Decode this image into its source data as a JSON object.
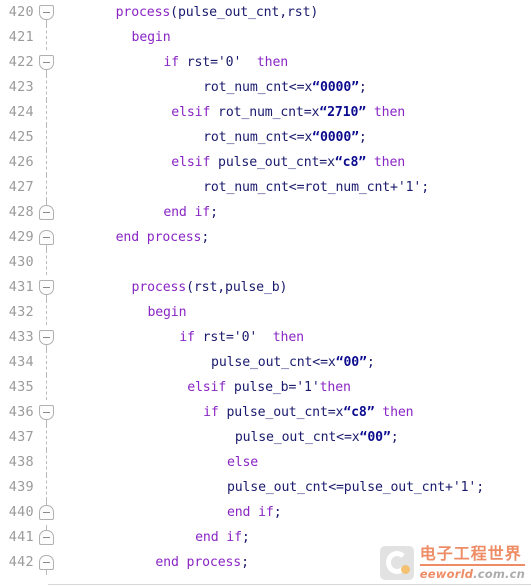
{
  "editor": {
    "title": "VHDL code listing",
    "language": "VHDL",
    "first_line": 420,
    "last_line": 442,
    "colors": {
      "background": "#ffffff",
      "line_number": "#9b9b9b",
      "identifier": "#101078",
      "keyword": "#8a26c4",
      "string": "#0b0b8f",
      "fold_marker": "#b0b0b0"
    }
  },
  "lines": [
    {
      "number": "420",
      "fold": "start",
      "connector": "bottom-half",
      "indent": 7,
      "tokens": [
        {
          "t": "kw",
          "v": "process"
        },
        {
          "t": "pun",
          "v": "(pulse_out_cnt,rst)"
        }
      ]
    },
    {
      "number": "421",
      "fold": "none",
      "connector": "full",
      "indent": 9,
      "tokens": [
        {
          "t": "kw",
          "v": "begin"
        }
      ]
    },
    {
      "number": "422",
      "fold": "start",
      "connector": "bottom-half",
      "indent": 13,
      "tokens": [
        {
          "t": "kw",
          "v": "if"
        },
        {
          "t": "pun",
          "v": " rst="
        },
        {
          "t": "pun",
          "v": "'0'"
        },
        {
          "t": "pun",
          "v": "  "
        },
        {
          "t": "kw",
          "v": "then"
        }
      ]
    },
    {
      "number": "423",
      "fold": "none",
      "connector": "full",
      "indent": 18,
      "tokens": [
        {
          "t": "pun",
          "v": "rot_num_cnt<=x"
        },
        {
          "t": "str",
          "v": "“0000”"
        },
        {
          "t": "pun",
          "v": ";"
        }
      ]
    },
    {
      "number": "424",
      "fold": "none",
      "connector": "full",
      "indent": 14,
      "tokens": [
        {
          "t": "kw",
          "v": "elsif"
        },
        {
          "t": "pun",
          "v": " rot_num_cnt=x"
        },
        {
          "t": "str",
          "v": "“2710”"
        },
        {
          "t": "pun",
          "v": " "
        },
        {
          "t": "kw",
          "v": "then"
        }
      ]
    },
    {
      "number": "425",
      "fold": "none",
      "connector": "full",
      "indent": 18,
      "tokens": [
        {
          "t": "pun",
          "v": "rot_num_cnt<=x"
        },
        {
          "t": "str",
          "v": "“0000”"
        },
        {
          "t": "pun",
          "v": ";"
        }
      ]
    },
    {
      "number": "426",
      "fold": "none",
      "connector": "full",
      "indent": 14,
      "tokens": [
        {
          "t": "kw",
          "v": "elsif"
        },
        {
          "t": "pun",
          "v": " pulse_out_cnt=x"
        },
        {
          "t": "str",
          "v": "“c8”"
        },
        {
          "t": "pun",
          "v": " "
        },
        {
          "t": "kw",
          "v": "then"
        }
      ]
    },
    {
      "number": "427",
      "fold": "none",
      "connector": "full",
      "indent": 18,
      "tokens": [
        {
          "t": "pun",
          "v": "rot_num_cnt<=rot_num_cnt+"
        },
        {
          "t": "pun",
          "v": "'1'"
        },
        {
          "t": "pun",
          "v": ";"
        }
      ]
    },
    {
      "number": "428",
      "fold": "end",
      "connector": "top-half",
      "indent": 13,
      "tokens": [
        {
          "t": "kw",
          "v": "end if"
        },
        {
          "t": "pun",
          "v": ";"
        }
      ]
    },
    {
      "number": "429",
      "fold": "end",
      "connector": "bottom-half",
      "indent": 7,
      "tokens": [
        {
          "t": "kw",
          "v": "end process"
        },
        {
          "t": "pun",
          "v": ";"
        }
      ]
    },
    {
      "number": "430",
      "fold": "none",
      "connector": "full",
      "indent": 0,
      "tokens": []
    },
    {
      "number": "431",
      "fold": "start",
      "connector": "bottom-half",
      "indent": 9,
      "tokens": [
        {
          "t": "kw",
          "v": "process"
        },
        {
          "t": "pun",
          "v": "(rst,pulse_b)"
        }
      ]
    },
    {
      "number": "432",
      "fold": "none",
      "connector": "full",
      "indent": 11,
      "tokens": [
        {
          "t": "kw",
          "v": "begin"
        }
      ]
    },
    {
      "number": "433",
      "fold": "start",
      "connector": "bottom-half",
      "indent": 15,
      "tokens": [
        {
          "t": "kw",
          "v": "if"
        },
        {
          "t": "pun",
          "v": " rst="
        },
        {
          "t": "pun",
          "v": "'0'"
        },
        {
          "t": "pun",
          "v": "  "
        },
        {
          "t": "kw",
          "v": "then"
        }
      ]
    },
    {
      "number": "434",
      "fold": "none",
      "connector": "full",
      "indent": 19,
      "tokens": [
        {
          "t": "pun",
          "v": "pulse_out_cnt<=x"
        },
        {
          "t": "str",
          "v": "“00”"
        },
        {
          "t": "pun",
          "v": ";"
        }
      ]
    },
    {
      "number": "435",
      "fold": "none",
      "connector": "full",
      "indent": 16,
      "tokens": [
        {
          "t": "kw",
          "v": "elsif"
        },
        {
          "t": "pun",
          "v": " pulse_b="
        },
        {
          "t": "pun",
          "v": "'1'"
        },
        {
          "t": "kw",
          "v": "then"
        }
      ]
    },
    {
      "number": "436",
      "fold": "start",
      "connector": "bottom-half",
      "indent": 18,
      "tokens": [
        {
          "t": "kw",
          "v": "if"
        },
        {
          "t": "pun",
          "v": " pulse_out_cnt=x"
        },
        {
          "t": "str",
          "v": "“c8”"
        },
        {
          "t": "pun",
          "v": " "
        },
        {
          "t": "kw",
          "v": "then"
        }
      ]
    },
    {
      "number": "437",
      "fold": "none",
      "connector": "full",
      "indent": 22,
      "tokens": [
        {
          "t": "pun",
          "v": "pulse_out_cnt<=x"
        },
        {
          "t": "str",
          "v": "“00”"
        },
        {
          "t": "pun",
          "v": ";"
        }
      ]
    },
    {
      "number": "438",
      "fold": "none",
      "connector": "full",
      "indent": 21,
      "tokens": [
        {
          "t": "kw",
          "v": "else"
        }
      ]
    },
    {
      "number": "439",
      "fold": "none",
      "connector": "full",
      "indent": 21,
      "tokens": [
        {
          "t": "pun",
          "v": "pulse_out_cnt<=pulse_out_cnt+"
        },
        {
          "t": "pun",
          "v": "'1'"
        },
        {
          "t": "pun",
          "v": ";"
        }
      ]
    },
    {
      "number": "440",
      "fold": "end",
      "connector": "top-half",
      "indent": 21,
      "tokens": [
        {
          "t": "kw",
          "v": "end if"
        },
        {
          "t": "pun",
          "v": ";"
        }
      ]
    },
    {
      "number": "441",
      "fold": "end",
      "connector": "top-half",
      "indent": 17,
      "tokens": [
        {
          "t": "kw",
          "v": "end if"
        },
        {
          "t": "pun",
          "v": ";"
        }
      ]
    },
    {
      "number": "442",
      "fold": "end",
      "connector": "bottom-half",
      "indent": 12,
      "tokens": [
        {
          "t": "kw",
          "v": "end process"
        },
        {
          "t": "pun",
          "v": ";"
        }
      ]
    }
  ],
  "watermark": {
    "icon": "eeworld-c-logo",
    "chinese": "电子工程世界",
    "brand": "eeworld",
    "domain": ".com.cn"
  }
}
